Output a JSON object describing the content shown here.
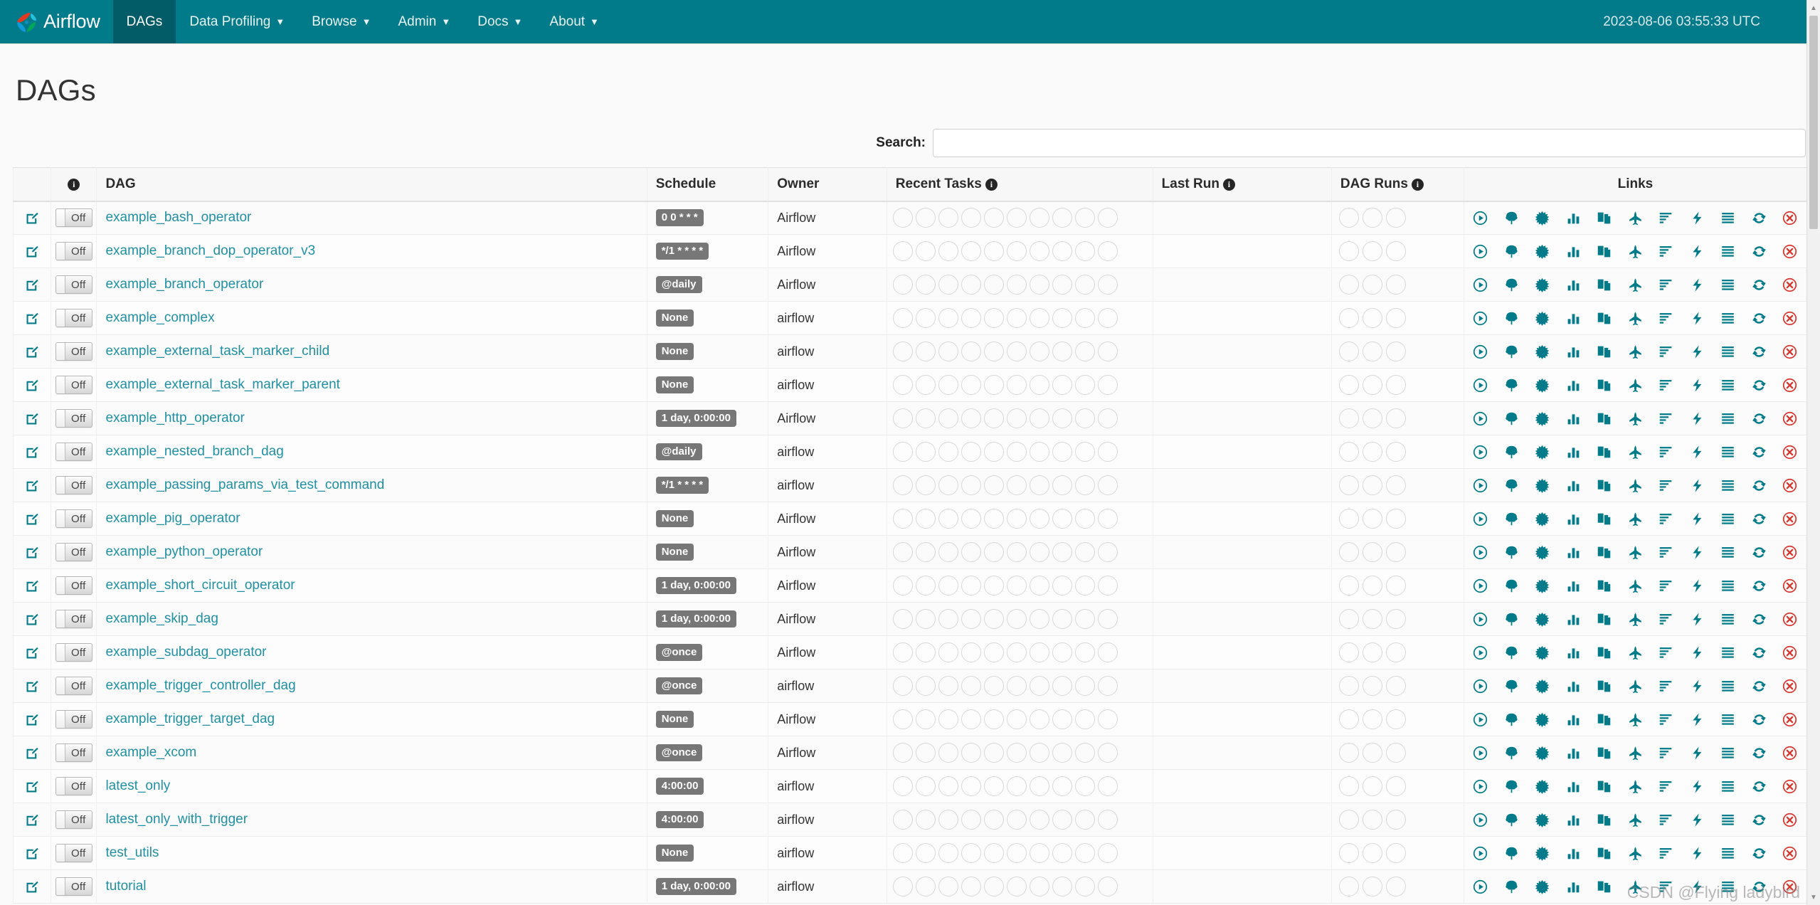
{
  "navbar": {
    "brand": "Airflow",
    "brand_logo_icon": "airflow-pinwheel-logo",
    "items": [
      {
        "label": "DAGs",
        "caret": "",
        "active": true
      },
      {
        "label": "Data Profiling",
        "caret": "⌄",
        "active": false
      },
      {
        "label": "Browse",
        "caret": "⌄",
        "active": false
      },
      {
        "label": "Admin",
        "caret": "⌄",
        "active": false
      },
      {
        "label": "Docs",
        "caret": "⌄",
        "active": false
      },
      {
        "label": "About",
        "caret": "⌄",
        "active": false
      }
    ],
    "clock": "2023-08-06 03:55:33 UTC"
  },
  "page": {
    "title": "DAGs"
  },
  "search": {
    "label": "Search:",
    "value": "",
    "placeholder": ""
  },
  "table": {
    "headers": {
      "edit": "",
      "info": "info-icon",
      "dag": "DAG",
      "schedule": "Schedule",
      "owner": "Owner",
      "recent_tasks": "Recent Tasks",
      "last_run": "Last Run",
      "dag_runs": "DAG Runs",
      "links": "Links"
    },
    "toggle_label": "Off",
    "recent_tasks_circle_count": 10,
    "dag_runs_circle_count": 3,
    "link_icons": [
      "trigger-dag-icon",
      "tree-view-icon",
      "graph-view-icon",
      "task-duration-icon",
      "task-tries-icon",
      "landing-times-icon",
      "gantt-icon",
      "code-icon",
      "logs-icon",
      "refresh-icon",
      "delete-dag-icon"
    ],
    "rows": [
      {
        "toggle": "Off",
        "dag": "example_bash_operator",
        "schedule": "0 0 * * *",
        "owner": "Airflow",
        "last_run": ""
      },
      {
        "toggle": "Off",
        "dag": "example_branch_dop_operator_v3",
        "schedule": "*/1 * * * *",
        "owner": "Airflow",
        "last_run": ""
      },
      {
        "toggle": "Off",
        "dag": "example_branch_operator",
        "schedule": "@daily",
        "owner": "Airflow",
        "last_run": ""
      },
      {
        "toggle": "Off",
        "dag": "example_complex",
        "schedule": "None",
        "owner": "airflow",
        "last_run": ""
      },
      {
        "toggle": "Off",
        "dag": "example_external_task_marker_child",
        "schedule": "None",
        "owner": "airflow",
        "last_run": ""
      },
      {
        "toggle": "Off",
        "dag": "example_external_task_marker_parent",
        "schedule": "None",
        "owner": "airflow",
        "last_run": ""
      },
      {
        "toggle": "Off",
        "dag": "example_http_operator",
        "schedule": "1 day, 0:00:00",
        "owner": "Airflow",
        "last_run": ""
      },
      {
        "toggle": "Off",
        "dag": "example_nested_branch_dag",
        "schedule": "@daily",
        "owner": "airflow",
        "last_run": ""
      },
      {
        "toggle": "Off",
        "dag": "example_passing_params_via_test_command",
        "schedule": "*/1 * * * *",
        "owner": "airflow",
        "last_run": ""
      },
      {
        "toggle": "Off",
        "dag": "example_pig_operator",
        "schedule": "None",
        "owner": "Airflow",
        "last_run": ""
      },
      {
        "toggle": "Off",
        "dag": "example_python_operator",
        "schedule": "None",
        "owner": "Airflow",
        "last_run": ""
      },
      {
        "toggle": "Off",
        "dag": "example_short_circuit_operator",
        "schedule": "1 day, 0:00:00",
        "owner": "Airflow",
        "last_run": ""
      },
      {
        "toggle": "Off",
        "dag": "example_skip_dag",
        "schedule": "1 day, 0:00:00",
        "owner": "Airflow",
        "last_run": ""
      },
      {
        "toggle": "Off",
        "dag": "example_subdag_operator",
        "schedule": "@once",
        "owner": "Airflow",
        "last_run": ""
      },
      {
        "toggle": "Off",
        "dag": "example_trigger_controller_dag",
        "schedule": "@once",
        "owner": "airflow",
        "last_run": ""
      },
      {
        "toggle": "Off",
        "dag": "example_trigger_target_dag",
        "schedule": "None",
        "owner": "Airflow",
        "last_run": ""
      },
      {
        "toggle": "Off",
        "dag": "example_xcom",
        "schedule": "@once",
        "owner": "Airflow",
        "last_run": ""
      },
      {
        "toggle": "Off",
        "dag": "latest_only",
        "schedule": "4:00:00",
        "owner": "airflow",
        "last_run": ""
      },
      {
        "toggle": "Off",
        "dag": "latest_only_with_trigger",
        "schedule": "4:00:00",
        "owner": "airflow",
        "last_run": ""
      },
      {
        "toggle": "Off",
        "dag": "test_utils",
        "schedule": "None",
        "owner": "airflow",
        "last_run": ""
      },
      {
        "toggle": "Off",
        "dag": "tutorial",
        "schedule": "1 day, 0:00:00",
        "owner": "airflow",
        "last_run": ""
      }
    ]
  },
  "watermark": "CSDN @Flying ladybird",
  "colors": {
    "navbar": "#017b8a",
    "navbar_active": "#015c68",
    "link": "#1f90a3",
    "badge": "#777777",
    "delete": "#d9352c"
  }
}
